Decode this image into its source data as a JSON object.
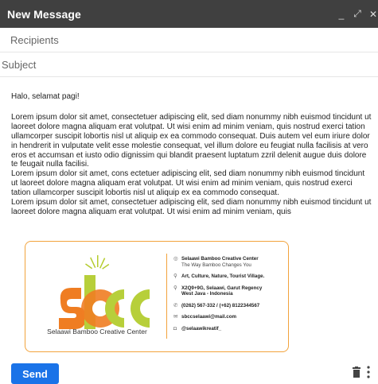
{
  "window": {
    "title": "New Message",
    "controls": [
      "_",
      "⤢",
      "✕"
    ]
  },
  "fields": {
    "recipients_placeholder": "Recipients",
    "subject_placeholder": "Subject"
  },
  "body": {
    "greeting": "Halo, selamat pagi!",
    "paragraph": "Lorem ipsum dolor sit amet, consectetuer adipiscing elit, sed diam nonummy nibh euismod tincidunt ut laoreet dolore magna aliquam erat volutpat. Ut wisi enim ad minim veniam, quis nostrud exerci tation ullamcorper suscipit lobortis nisl ut aliquip ex ea commodo consequat. Duis autem vel eum iriure dolor in hendrerit in vulputate velit esse molestie consequat, vel illum dolore eu feugiat nulla facilisis at vero eros et accumsan et iusto odio dignissim qui blandit praesent luptatum zzril delenit augue duis dolore te feugait nulla facilisi.",
    "paragraph2": "Lorem ipsum dolor sit amet, cons ectetuer adipiscing elit, sed diam nonummy nibh euismod tincidunt ut laoreet dolore magna aliquam erat volutpat. Ut wisi enim ad minim veniam, quis nostrud exerci tation ullamcorper suscipit lobortis nisl ut aliquip ex ea commodo consequat.",
    "paragraph3": "Lorem ipsum dolor sit amet, consectetuer adipiscing elit, sed diam nonummy nibh euismod tincidunt ut laoreet dolore magna aliquam erat volutpat. Ut wisi enim ad minim veniam, quis"
  },
  "signature": {
    "logo_text": "sbcc",
    "logo_caption": "Selaawi Bamboo Creative Center",
    "name": "Selaawi Bamboo Creative Center",
    "tagline": "The Way Bamboo Changes You",
    "tags": "Art, Culture, Nature, Tourist Village.",
    "address": "X2Q9+9G, Selaawi, Garut Regency",
    "address2": "West Java - Indonesia",
    "phone": "(0262) 567-332 / (+62) 8122344567",
    "email": "sbccselaawi@mail.com",
    "instagram": "@selaawikreatif_",
    "colors": {
      "border": "#f2a33c",
      "green": "#b7cf3a",
      "orange": "#ef7d22",
      "leaf": "#b5cc2e"
    }
  },
  "actions": {
    "send_label": "Send",
    "send_color": "#1a73e8"
  }
}
